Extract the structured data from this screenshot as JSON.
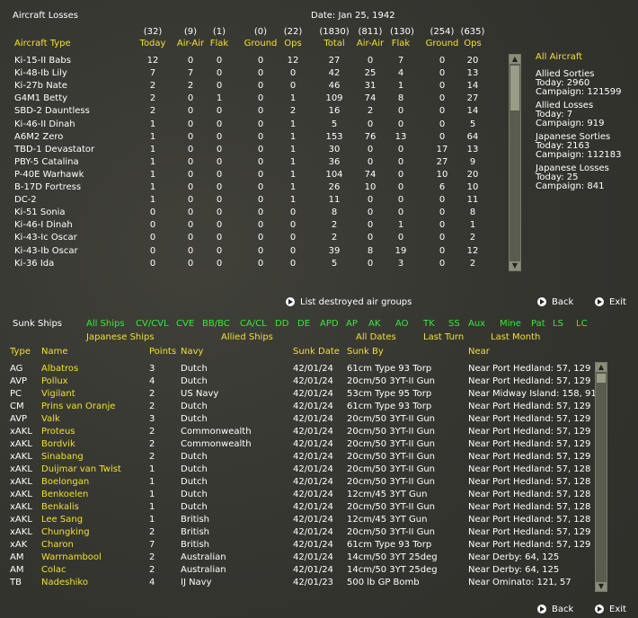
{
  "top": {
    "title": "Aircraft Losses",
    "date": "Date: Jan 25, 1942",
    "totals": [
      "(32)",
      "(9)",
      "(1)",
      "(0)",
      "(22)",
      "(1830)",
      "(811)",
      "(130)",
      "(254)",
      "(635)"
    ],
    "col_headers": [
      "Aircraft Type",
      "Today",
      "Air-Air",
      "Flak",
      "Ground",
      "Ops",
      "Total",
      "Air-Air",
      "Flak",
      "Ground",
      "Ops"
    ],
    "rows": [
      [
        "Ki-15-II Babs",
        "12",
        "0",
        "0",
        "0",
        "12",
        "27",
        "0",
        "7",
        "0",
        "20"
      ],
      [
        "Ki-48-Ib Lily",
        "7",
        "7",
        "0",
        "0",
        "0",
        "42",
        "25",
        "4",
        "0",
        "13"
      ],
      [
        "Ki-27b Nate",
        "2",
        "2",
        "0",
        "0",
        "0",
        "46",
        "31",
        "1",
        "0",
        "14"
      ],
      [
        "G4M1 Betty",
        "2",
        "0",
        "1",
        "0",
        "1",
        "109",
        "74",
        "8",
        "0",
        "27"
      ],
      [
        "SBD-2 Dauntless",
        "2",
        "0",
        "0",
        "0",
        "2",
        "16",
        "2",
        "0",
        "0",
        "14"
      ],
      [
        "Ki-46-II Dinah",
        "1",
        "0",
        "0",
        "0",
        "1",
        "5",
        "0",
        "0",
        "0",
        "5"
      ],
      [
        "A6M2 Zero",
        "1",
        "0",
        "0",
        "0",
        "1",
        "153",
        "76",
        "13",
        "0",
        "64"
      ],
      [
        "TBD-1 Devastator",
        "1",
        "0",
        "0",
        "0",
        "1",
        "30",
        "0",
        "0",
        "17",
        "13"
      ],
      [
        "PBY-5 Catalina",
        "1",
        "0",
        "0",
        "0",
        "1",
        "36",
        "0",
        "0",
        "27",
        "9"
      ],
      [
        "P-40E Warhawk",
        "1",
        "0",
        "0",
        "0",
        "1",
        "104",
        "74",
        "0",
        "10",
        "20"
      ],
      [
        "B-17D Fortress",
        "1",
        "0",
        "0",
        "0",
        "1",
        "26",
        "10",
        "0",
        "6",
        "10"
      ],
      [
        "DC-2",
        "1",
        "0",
        "0",
        "0",
        "1",
        "11",
        "0",
        "0",
        "0",
        "11"
      ],
      [
        "Ki-51 Sonia",
        "0",
        "0",
        "0",
        "0",
        "0",
        "8",
        "0",
        "0",
        "0",
        "8"
      ],
      [
        "Ki-46-I Dinah",
        "0",
        "0",
        "0",
        "0",
        "0",
        "2",
        "0",
        "1",
        "0",
        "1"
      ],
      [
        "Ki-43-Ic Oscar",
        "0",
        "0",
        "0",
        "0",
        "0",
        "2",
        "0",
        "0",
        "0",
        "2"
      ],
      [
        "Ki-43-Ib Oscar",
        "0",
        "0",
        "0",
        "0",
        "0",
        "39",
        "8",
        "19",
        "0",
        "12"
      ],
      [
        "Ki-36 Ida",
        "0",
        "0",
        "0",
        "0",
        "0",
        "5",
        "0",
        "3",
        "0",
        "2"
      ]
    ],
    "side": {
      "all_aircraft": "All Aircraft",
      "allied_sorties": "Allied Sorties",
      "allied_sorties_today": "Today:   2960",
      "allied_sorties_campaign": "Campaign: 121599",
      "allied_losses": "Allied Losses",
      "allied_losses_today": "Today:   7",
      "allied_losses_campaign": "Campaign: 919",
      "japanese_sorties": "Japanese Sorties",
      "japanese_sorties_today": "Today:   2163",
      "japanese_sorties_campaign": "Campaign: 112183",
      "japanese_losses": "Japanese Losses",
      "japanese_losses_today": "Today:   25",
      "japanese_losses_campaign": "Campaign: 841"
    },
    "list_destroyed": "List destroyed air groups",
    "back": "Back",
    "exit": "Exit"
  },
  "bottom": {
    "title": "Sunk Ships",
    "filters_row1": [
      "All Ships",
      "CV/CVL",
      "CVE",
      "BB/BC",
      "CA/CL",
      "DD",
      "DE",
      "APD",
      "AP",
      "AK",
      "AO",
      "TK",
      "SS",
      "Aux",
      "Mine",
      "Pat",
      "LS",
      "LC"
    ],
    "filters_row2": [
      "Japanese Ships",
      "Allied Ships",
      "All Dates",
      "Last Turn",
      "Last Month"
    ],
    "col_headers": [
      "Type",
      "Name",
      "Points",
      "Navy",
      "Sunk Date",
      "Sunk By",
      "Near"
    ],
    "rows": [
      [
        "AG",
        "Albatros",
        "3",
        "Dutch",
        "42/01/24",
        "61cm Type 93 Torp",
        "Near Port Hedland: 57, 129"
      ],
      [
        "AVP",
        "Pollux",
        "4",
        "Dutch",
        "42/01/24",
        "20cm/50 3YT-II Gun",
        "Near Port Hedland: 57, 129"
      ],
      [
        "PC",
        "Vigilant",
        "2",
        "US Navy",
        "42/01/24",
        "53cm Type 95 Torp",
        "Near Midway Island: 158, 91"
      ],
      [
        "CM",
        "Prins van Oranje",
        "2",
        "Dutch",
        "42/01/24",
        "61cm Type 93 Torp",
        "Near Port Hedland: 57, 129"
      ],
      [
        "AVP",
        "Valk",
        "3",
        "Dutch",
        "42/01/24",
        "20cm/50 3YT-II Gun",
        "Near Port Hedland: 57, 129"
      ],
      [
        "xAKL",
        "Proteus",
        "2",
        "Commonwealth",
        "42/01/24",
        "20cm/50 3YT-II Gun",
        "Near Port Hedland: 57, 129"
      ],
      [
        "xAKL",
        "Bordvik",
        "2",
        "Commonwealth",
        "42/01/24",
        "20cm/50 3YT-II Gun",
        "Near Port Hedland: 57, 129"
      ],
      [
        "xAKL",
        "Sinabang",
        "2",
        "Dutch",
        "42/01/24",
        "20cm/50 3YT-II Gun",
        "Near Port Hedland: 57, 129"
      ],
      [
        "xAKL",
        "Duijmar van Twist",
        "1",
        "Dutch",
        "42/01/24",
        "20cm/50 3YT-II Gun",
        "Near Port Hedland: 57, 128"
      ],
      [
        "xAKL",
        "Boelongan",
        "1",
        "Dutch",
        "42/01/24",
        "20cm/50 3YT-II Gun",
        "Near Port Hedland: 57, 128"
      ],
      [
        "xAKL",
        "Benkoelen",
        "1",
        "Dutch",
        "42/01/24",
        "12cm/45 3YT Gun",
        "Near Port Hedland: 57, 128"
      ],
      [
        "xAKL",
        "Benkalis",
        "1",
        "Dutch",
        "42/01/24",
        "20cm/50 3YT-II Gun",
        "Near Port Hedland: 57, 128"
      ],
      [
        "xAKL",
        "Lee Sang",
        "1",
        "British",
        "42/01/24",
        "12cm/45 3YT Gun",
        "Near Port Hedland: 57, 128"
      ],
      [
        "xAKL",
        "Chungking",
        "2",
        "British",
        "42/01/24",
        "20cm/50 3YT-II Gun",
        "Near Port Hedland: 57, 129"
      ],
      [
        "xAK",
        "Charon",
        "7",
        "British",
        "42/01/24",
        "61cm Type 93 Torp",
        "Near Port Hedland: 57, 129"
      ],
      [
        "AM",
        "Warrnambool",
        "2",
        "Australian",
        "42/01/24",
        "14cm/50 3YT 25deg",
        "Near Derby: 64, 125"
      ],
      [
        "AM",
        "Colac",
        "2",
        "Australian",
        "42/01/24",
        "14cm/50 3YT 25deg",
        "Near Derby: 64, 125"
      ],
      [
        "TB",
        "Nadeshiko",
        "4",
        "IJ Navy",
        "42/01/23",
        "500 lb GP Bomb",
        "Near Ominato: 121, 57"
      ]
    ],
    "back": "Back",
    "exit": "Exit"
  }
}
